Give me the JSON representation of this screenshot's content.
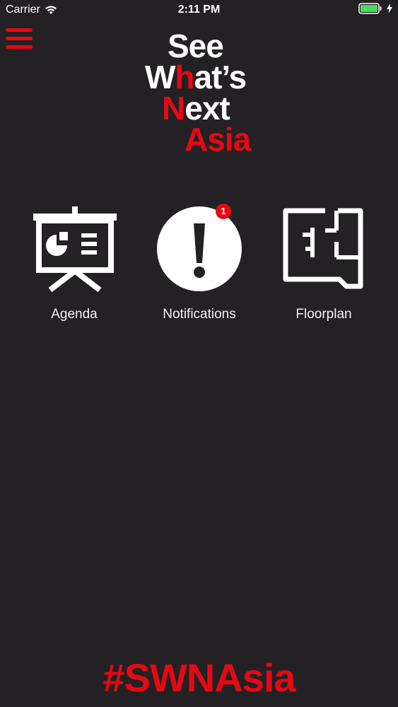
{
  "status_bar": {
    "carrier": "Carrier",
    "time": "2:11 PM",
    "battery_color": "#4cd964"
  },
  "header": {
    "menu_icon": "hamburger-icon"
  },
  "logo": {
    "line1": "See",
    "line2_a": "W",
    "line2_b": "h",
    "line2_c": "at’s",
    "line3_a": "N",
    "line3_b": "ext",
    "line4": "Asia"
  },
  "tiles": [
    {
      "label": "Agenda",
      "icon": "presentation-board-icon"
    },
    {
      "label": "Notifications",
      "icon": "exclamation-icon",
      "badge": "1"
    },
    {
      "label": "Floorplan",
      "icon": "floorplan-icon"
    }
  ],
  "footer": {
    "hashtag": "#SWNAsia"
  },
  "colors": {
    "accent": "#e50914",
    "background": "#232123"
  }
}
